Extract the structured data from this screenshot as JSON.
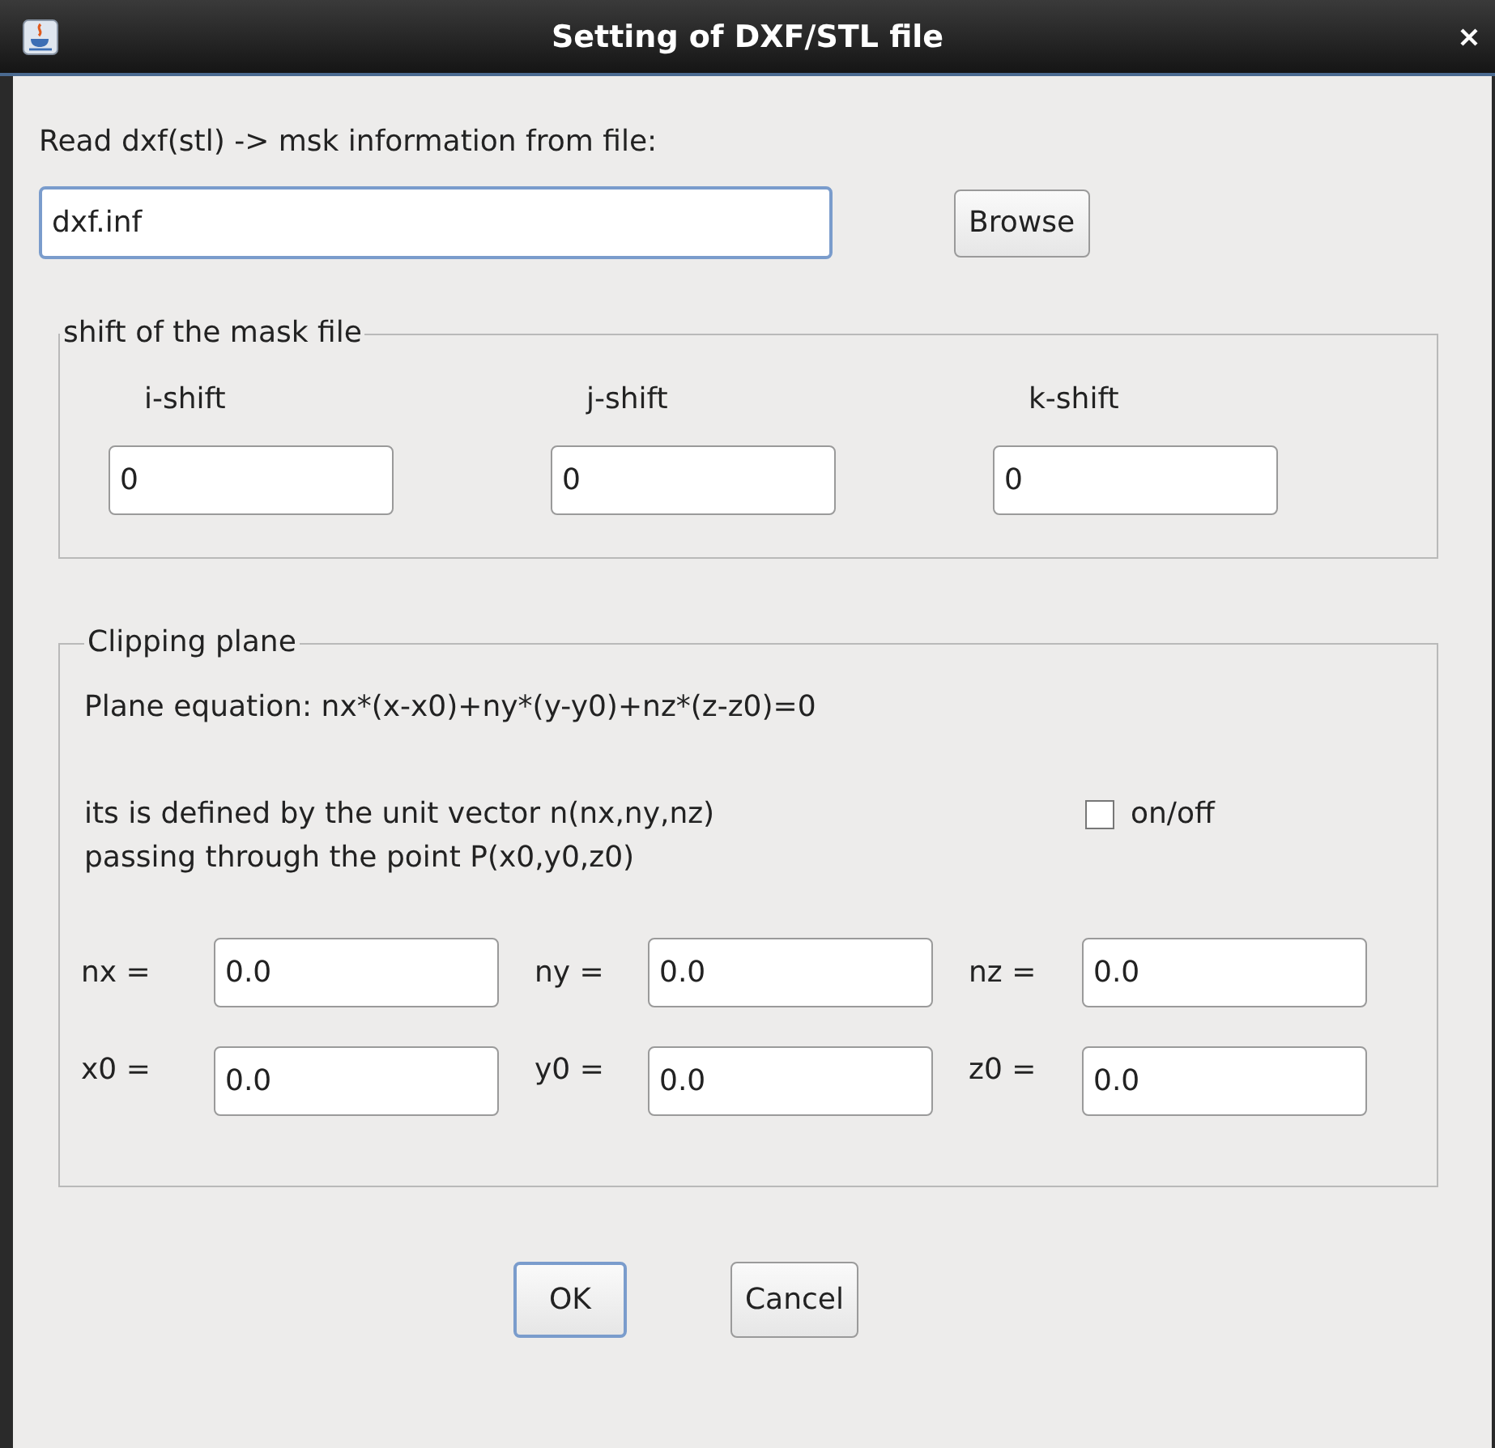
{
  "window": {
    "title": "Setting of DXF/STL file"
  },
  "file": {
    "label": "Read dxf(stl) -> msk information from file:",
    "value": "dxf.inf",
    "focused": true,
    "browse": "Browse"
  },
  "shift": {
    "legend": "shift of the mask file",
    "fields": [
      {
        "label": "i-shift",
        "value": "0"
      },
      {
        "label": "j-shift",
        "value": "0"
      },
      {
        "label": "k-shift",
        "value": "0"
      }
    ]
  },
  "clipping": {
    "legend": "Clipping plane",
    "equation": "Plane equation: nx*(x-x0)+ny*(y-y0)+nz*(z-z0)=0",
    "description": [
      "its is defined by the unit vector n(nx,ny,nz)",
      "passing through the point P(x0,y0,z0)"
    ],
    "toggle": {
      "label": "on/off",
      "checked": false
    },
    "fields": [
      {
        "label": "nx =",
        "value": "0.0"
      },
      {
        "label": "ny =",
        "value": "0.0"
      },
      {
        "label": "nz =",
        "value": "0.0"
      },
      {
        "label": "x0 =",
        "value": "0.0"
      },
      {
        "label": "y0 =",
        "value": "0.0"
      },
      {
        "label": "z0 =",
        "value": "0.0"
      }
    ]
  },
  "buttons": [
    {
      "label": "OK",
      "default": true
    },
    {
      "label": "Cancel",
      "default": false
    }
  ]
}
